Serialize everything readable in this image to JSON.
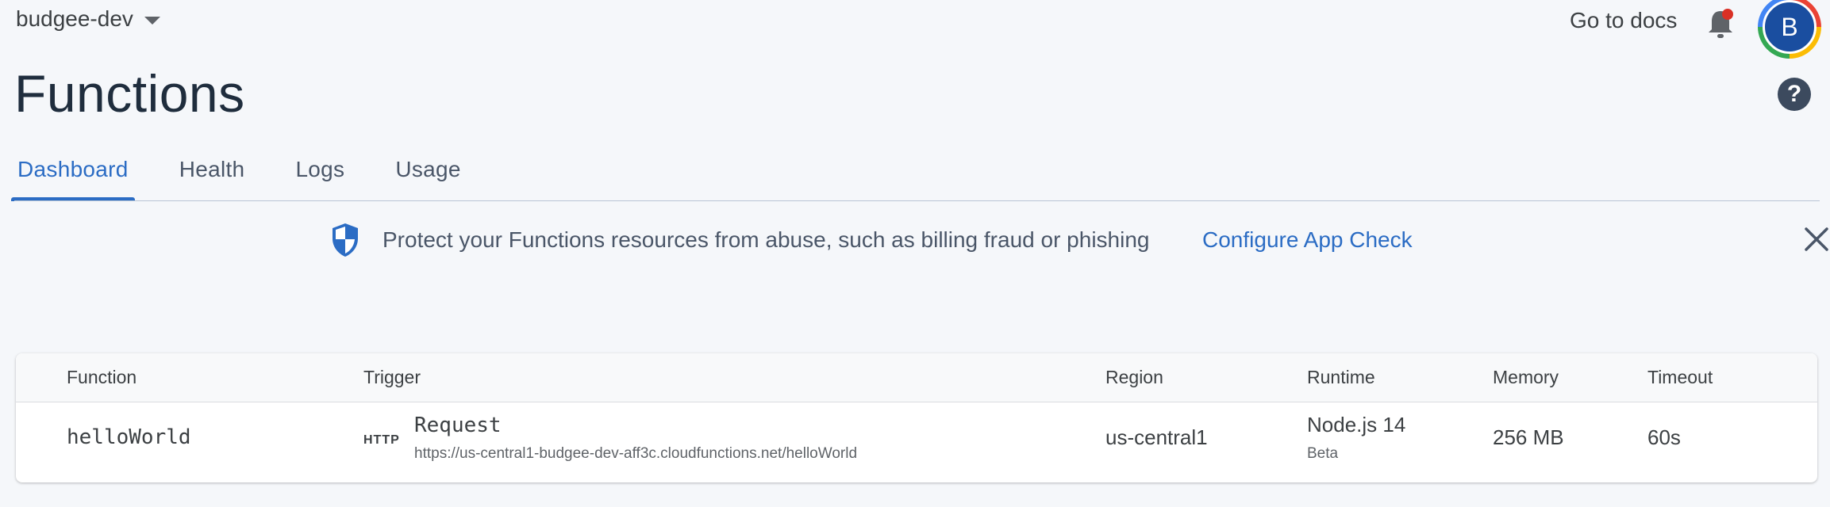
{
  "header": {
    "project": "budgee-dev",
    "docs_link": "Go to docs",
    "avatar_initial": "B"
  },
  "page": {
    "title": "Functions",
    "help": "?"
  },
  "tabs": [
    {
      "label": "Dashboard",
      "active": true
    },
    {
      "label": "Health",
      "active": false
    },
    {
      "label": "Logs",
      "active": false
    },
    {
      "label": "Usage",
      "active": false
    }
  ],
  "banner": {
    "icon": "shield-icon",
    "text": "Protect your Functions resources from abuse, such as billing fraud or phishing",
    "link": "Configure App Check"
  },
  "table": {
    "columns": [
      "Function",
      "Trigger",
      "Region",
      "Runtime",
      "Memory",
      "Timeout"
    ],
    "rows": [
      {
        "function": "helloWorld",
        "trigger_type": "HTTP",
        "trigger_name": "Request",
        "trigger_url": "https://us-central1-budgee-dev-aff3c.cloudfunctions.net/helloWorld",
        "region": "us-central1",
        "runtime": "Node.js 14",
        "runtime_tag": "Beta",
        "memory": "256 MB",
        "timeout": "60s"
      }
    ]
  },
  "colors": {
    "accent": "#2b6cc4",
    "avatar": "#1a4ea0",
    "background": "#f5f7fa"
  }
}
